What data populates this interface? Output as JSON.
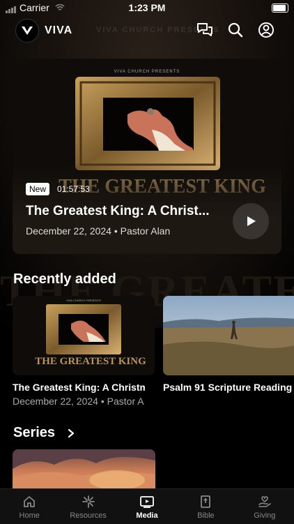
{
  "status_bar": {
    "carrier": "Carrier",
    "time": "1:23 PM"
  },
  "header": {
    "brand": "VIVA",
    "watermark": "VIVA CHURCH PRESENTS"
  },
  "hero": {
    "art_presents": "VIVA CHURCH PRESENTS",
    "art_title": "THE GREATEST KING",
    "badge": "New",
    "duration": "01:57:53",
    "title": "The Greatest King: A Christ...",
    "date": "December 22, 2024",
    "separator": "•",
    "speaker": "Pastor Alan"
  },
  "recent": {
    "title": "Recently added",
    "items": [
      {
        "title": "The Greatest King: A Christmas",
        "date": "December 22, 2024",
        "separator": "•",
        "speaker": "Pastor A",
        "art_title": "THE GREATEST KING",
        "art_presents": "VIVA CHURCH PRESENTS"
      },
      {
        "title": "Psalm 91 Scripture Reading"
      }
    ]
  },
  "series": {
    "title": "Series"
  },
  "tabbar": {
    "items": [
      {
        "label": "Home",
        "icon": "home-icon"
      },
      {
        "label": "Resources",
        "icon": "resources-icon"
      },
      {
        "label": "Media",
        "icon": "media-icon",
        "active": true
      },
      {
        "label": "Bible",
        "icon": "bible-icon"
      },
      {
        "label": "Giving",
        "icon": "giving-icon"
      }
    ]
  },
  "colors": {
    "background": "#000000",
    "hero_card": "#1e1813",
    "tab_active": "#ffffff",
    "tab_inactive": "#888888"
  }
}
